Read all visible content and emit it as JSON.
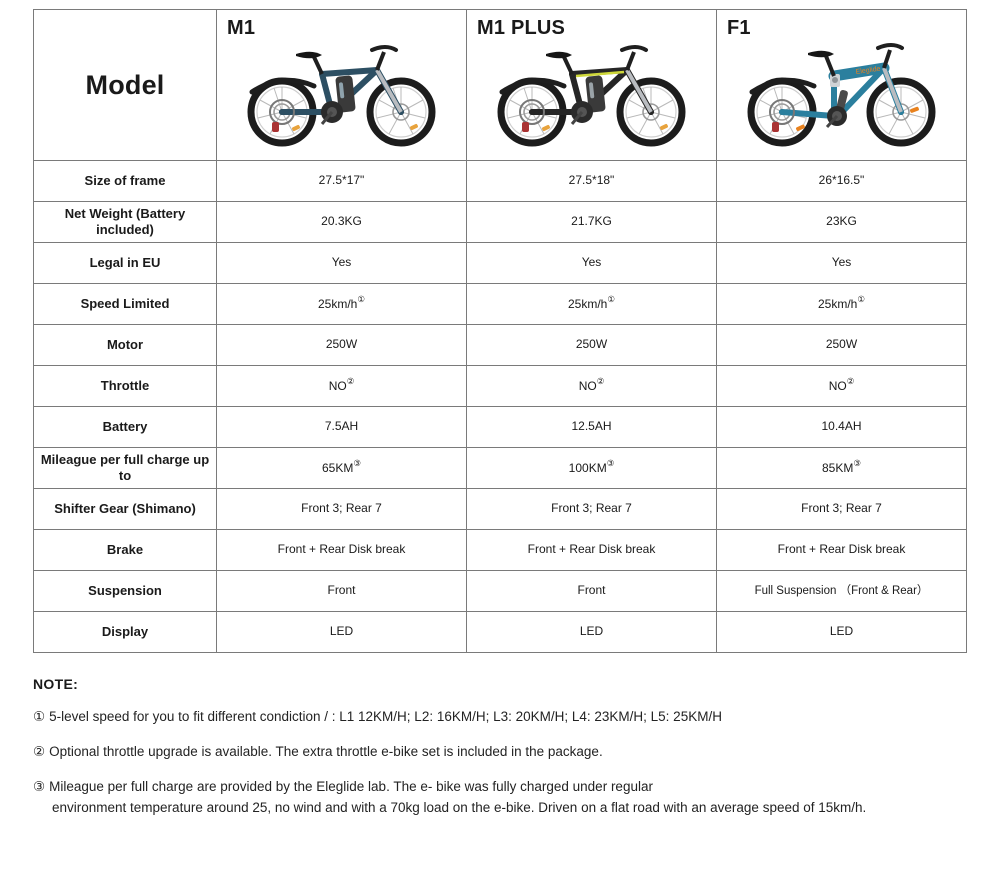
{
  "table": {
    "header": {
      "row_label": "Model",
      "models": [
        {
          "name": "M1",
          "image": "bike-m1",
          "frame_color": "#2d4f63",
          "accent": "#c0392b"
        },
        {
          "name": "M1 PLUS",
          "image": "bike-m1-plus",
          "frame_color": "#262626",
          "accent": "#cfd83a"
        },
        {
          "name": "F1",
          "image": "bike-f1",
          "frame_color": "#2b7f9e",
          "accent": "#e8821e"
        }
      ]
    },
    "rows": [
      {
        "label": "Size of frame",
        "values": [
          "27.5*17\"",
          "27.5*18\"",
          "26*16.5\""
        ],
        "sup": null
      },
      {
        "label": "Net Weight (Battery included)",
        "values": [
          "20.3KG",
          "21.7KG",
          "23KG"
        ],
        "sup": null
      },
      {
        "label": "Legal in EU",
        "values": [
          "Yes",
          "Yes",
          "Yes"
        ],
        "sup": null
      },
      {
        "label": "Speed Limited",
        "values": [
          "25km/h",
          "25km/h",
          "25km/h"
        ],
        "sup": "①"
      },
      {
        "label": "Motor",
        "values": [
          "250W",
          "250W",
          "250W"
        ],
        "sup": null
      },
      {
        "label": "Throttle",
        "values": [
          "NO",
          "NO",
          "NO"
        ],
        "sup": "②"
      },
      {
        "label": "Battery",
        "values": [
          "7.5AH",
          "12.5AH",
          "10.4AH"
        ],
        "sup": null
      },
      {
        "label": "Mileague per full charge up to",
        "values": [
          "65KM",
          "100KM",
          "85KM"
        ],
        "sup": "③"
      },
      {
        "label": "Shifter Gear (Shimano)",
        "values": [
          "Front 3; Rear 7",
          "Front 3; Rear 7",
          "Front 3; Rear 7"
        ],
        "sup": null
      },
      {
        "label": "Brake",
        "values": [
          "Front + Rear Disk break",
          "Front + Rear Disk break",
          "Front + Rear Disk break"
        ],
        "sup": null
      },
      {
        "label": "Suspension",
        "values": [
          "Front",
          "Front",
          "Full Suspension （Front & Rear）"
        ],
        "sup": null
      },
      {
        "label": "Display",
        "values": [
          "LED",
          "LED",
          "LED"
        ],
        "sup": null
      }
    ]
  },
  "notes": {
    "title": "NOTE:",
    "items": [
      {
        "marker": "①",
        "text": "5-level speed for you to fit different condiction / :  L1 12KM/H; L2: 16KM/H; L3: 20KM/H; L4: 23KM/H; L5: 25KM/H",
        "text2": ""
      },
      {
        "marker": "②",
        "text": "Optional throttle upgrade is available. The extra throttle e-bike set is included in the package.",
        "text2": ""
      },
      {
        "marker": "③",
        "text": "Mileague per full charge are provided by the Eleglide lab. The e- bike was fully charged under regular",
        "text2": "environment temperature around 25, no wind and with a 70kg load on  the e-bike. Driven on a flat road with an average speed of 15km/h."
      }
    ]
  },
  "colors": {
    "border": "#7a7a7a",
    "text": "#1a1a1a",
    "background": "#ffffff"
  }
}
